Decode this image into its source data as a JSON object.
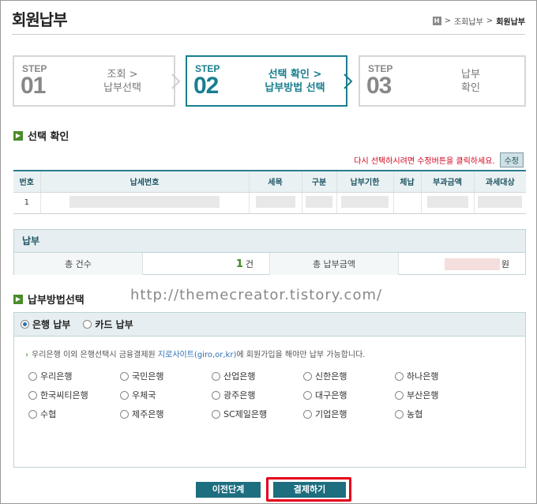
{
  "page": {
    "title": "회원납부"
  },
  "breadcrumb": {
    "home": "H",
    "items": [
      "조회납부",
      "회원납부"
    ],
    "separator": ">"
  },
  "steps": [
    {
      "word": "STEP",
      "num": "01",
      "label_line1": "조회 >",
      "label_line2": "납부선택",
      "active": false
    },
    {
      "word": "STEP",
      "num": "02",
      "label_line1": "선택 확인 >",
      "label_line2": "납부방법 선택",
      "active": true
    },
    {
      "word": "STEP",
      "num": "03",
      "label_line1": "납부",
      "label_line2": "확인",
      "active": false
    }
  ],
  "confirm_section": {
    "heading": "선택 확인",
    "notice": "다시 선택하시려면 수정버튼을 클릭하세요.",
    "edit_label": "수정",
    "columns": [
      "번호",
      "납세번호",
      "세목",
      "구분",
      "납부기한",
      "체납",
      "부과금액",
      "과세대상"
    ],
    "rows": [
      {
        "no": "1"
      }
    ]
  },
  "payment": {
    "heading": "납부",
    "count_label": "총 건수",
    "count_value": "1",
    "count_unit": "건",
    "amount_label": "총 납부금액",
    "amount_unit": "원"
  },
  "watermark": "http://themecreator.tistory.com/",
  "method_section": {
    "heading": "납부방법선택",
    "tabs": [
      {
        "label": "은행 납부",
        "selected": true
      },
      {
        "label": "카드 납부",
        "selected": false
      }
    ],
    "info_prefix": "우리은행 이외 은행선택시 금융결제원 ",
    "info_link": "지로사이트(giro,or,kr)",
    "info_suffix": "에 회원가입을 해야만 납부 가능합니다.",
    "banks": [
      "우리은행",
      "국민은행",
      "산업은행",
      "신한은행",
      "하나은행",
      "한국씨티은행",
      "우체국",
      "광주은행",
      "대구은행",
      "부산은행",
      "수협",
      "제주은행",
      "SC제일은행",
      "기업은행",
      "농협"
    ]
  },
  "buttons": {
    "prev": "이전단계",
    "pay": "결제하기"
  },
  "colors": {
    "accent": "#1a7e8f",
    "button": "#1d6e7f",
    "highlight": "#e3001b",
    "notice": "#d0021b"
  }
}
